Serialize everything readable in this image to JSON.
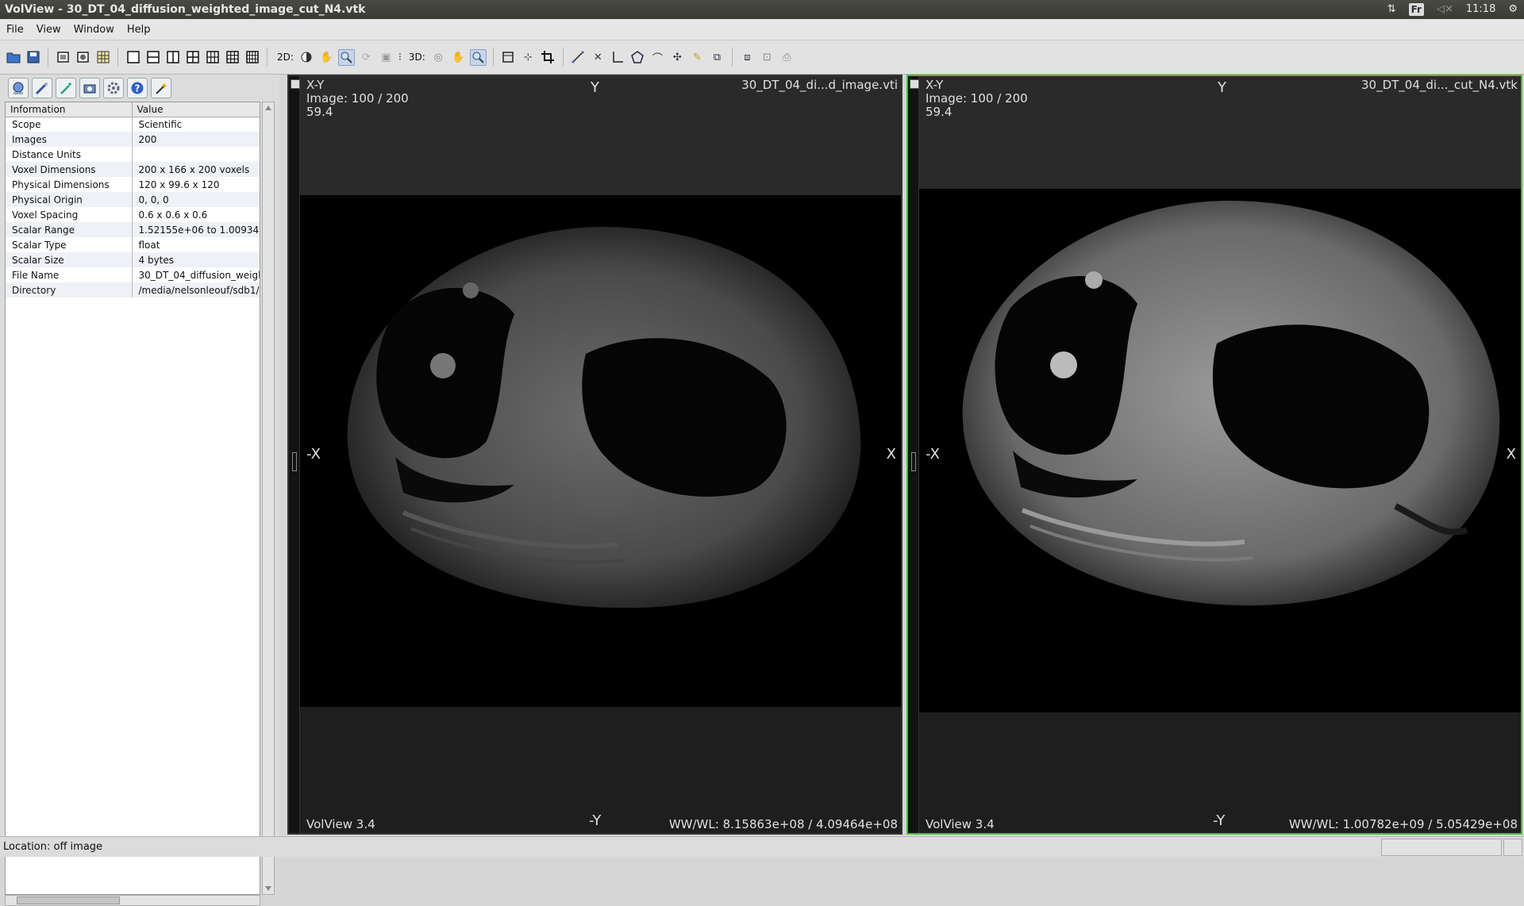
{
  "window": {
    "title": "VolView - 30_DT_04_diffusion_weighted_image_cut_N4.vtk"
  },
  "tray": {
    "keyboard": "Fr",
    "time": "11:18"
  },
  "menu": [
    {
      "label": "File"
    },
    {
      "label": "View"
    },
    {
      "label": "Window"
    },
    {
      "label": "Help"
    }
  ],
  "toolbar": {
    "label_2d": "2D:",
    "label_3d": "3D:"
  },
  "info_table": {
    "headers": [
      "Information",
      "Value"
    ],
    "rows": [
      {
        "key": "Scope",
        "value": "Scientific"
      },
      {
        "key": "Images",
        "value": "200"
      },
      {
        "key": "Distance Units",
        "value": ""
      },
      {
        "key": "Voxel Dimensions",
        "value": "200 x 166 x 200 voxels"
      },
      {
        "key": "Physical Dimensions",
        "value": "120 x 99.6 x 120"
      },
      {
        "key": "Physical Origin",
        "value": "0, 0, 0"
      },
      {
        "key": "Voxel Spacing",
        "value": "0.6 x 0.6 x 0.6"
      },
      {
        "key": "Scalar Range",
        "value": "1.52155e+06 to 1.00934"
      },
      {
        "key": "Scalar Type",
        "value": "float"
      },
      {
        "key": "Scalar Size",
        "value": "4 bytes"
      },
      {
        "key": "File Name",
        "value": "30_DT_04_diffusion_weigl"
      },
      {
        "key": "Directory",
        "value": "/media/nelsonleouf/sdb1/l"
      }
    ]
  },
  "viewers": [
    {
      "orientation": "X-Y",
      "image_index": "Image: 100 / 200",
      "slice_pos": "59.4",
      "filename": "30_DT_04_di...d_image.vti",
      "dir_top": "Y",
      "dir_bottom": "-Y",
      "dir_left": "-X",
      "dir_right": "X",
      "version": "VolView 3.4",
      "wwwl": "WW/WL: 8.15863e+08 / 4.09464e+08",
      "brightness": 0.45,
      "selected": false
    },
    {
      "orientation": "X-Y",
      "image_index": "Image: 100 / 200",
      "slice_pos": "59.4",
      "filename": "30_DT_04_di..._cut_N4.vtk",
      "dir_top": "Y",
      "dir_bottom": "-Y",
      "dir_left": "-X",
      "dir_right": "X",
      "version": "VolView 3.4",
      "wwwl": "WW/WL: 1.00782e+09 / 5.05429e+08",
      "brightness": 0.7,
      "selected": true
    }
  ],
  "status": {
    "location": "Location: off image"
  },
  "colors": {
    "selected_border": "#39c03a",
    "titlebar": "#3f3f3b"
  }
}
